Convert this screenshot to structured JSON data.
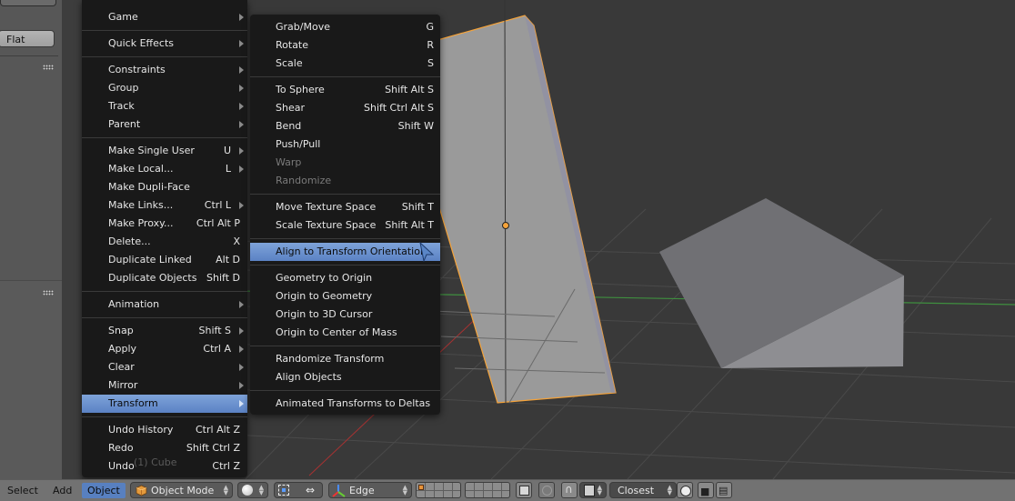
{
  "tool_shelf": {
    "shading_button": "Flat"
  },
  "viewport": {
    "object_label": "(1) Cube",
    "selection_color": "#f5a33a",
    "x_axis_color": "#a83232",
    "y_axis_color": "#3f8f3f"
  },
  "object_menu": {
    "items": [
      {
        "label": "Game",
        "shortcut": "",
        "submenu": true
      },
      {
        "label": "Quick Effects",
        "shortcut": "",
        "submenu": true
      },
      {
        "label": "Constraints",
        "shortcut": "",
        "submenu": true
      },
      {
        "label": "Group",
        "shortcut": "",
        "submenu": true
      },
      {
        "label": "Track",
        "shortcut": "",
        "submenu": true
      },
      {
        "label": "Parent",
        "shortcut": "",
        "submenu": true
      },
      {
        "label": "Make Single User",
        "shortcut": "U",
        "submenu": true
      },
      {
        "label": "Make Local...",
        "shortcut": "L",
        "submenu": true
      },
      {
        "label": "Make Dupli-Face",
        "shortcut": "",
        "submenu": false
      },
      {
        "label": "Make Links...",
        "shortcut": "Ctrl L",
        "submenu": true
      },
      {
        "label": "Make Proxy...",
        "shortcut": "Ctrl Alt P",
        "submenu": false
      },
      {
        "label": "Delete...",
        "shortcut": "X",
        "submenu": false
      },
      {
        "label": "Duplicate Linked",
        "shortcut": "Alt D",
        "submenu": false
      },
      {
        "label": "Duplicate Objects",
        "shortcut": "Shift D",
        "submenu": false
      },
      {
        "label": "Animation",
        "shortcut": "",
        "submenu": true
      },
      {
        "label": "Snap",
        "shortcut": "Shift S",
        "submenu": true
      },
      {
        "label": "Apply",
        "shortcut": "Ctrl A",
        "submenu": true
      },
      {
        "label": "Clear",
        "shortcut": "",
        "submenu": true
      },
      {
        "label": "Mirror",
        "shortcut": "",
        "submenu": true
      },
      {
        "label": "Transform",
        "shortcut": "",
        "submenu": true,
        "active": true
      },
      {
        "label": "Undo History",
        "shortcut": "Ctrl Alt Z",
        "submenu": false
      },
      {
        "label": "Redo",
        "shortcut": "Shift Ctrl Z",
        "submenu": false
      },
      {
        "label": "Undo",
        "shortcut": "Ctrl Z",
        "submenu": false
      }
    ]
  },
  "transform_menu": {
    "items": [
      {
        "label": "Grab/Move",
        "shortcut": "G"
      },
      {
        "label": "Rotate",
        "shortcut": "R"
      },
      {
        "label": "Scale",
        "shortcut": "S"
      },
      {
        "label": "To Sphere",
        "shortcut": "Shift Alt S"
      },
      {
        "label": "Shear",
        "shortcut": "Shift Ctrl Alt S"
      },
      {
        "label": "Bend",
        "shortcut": "Shift W"
      },
      {
        "label": "Push/Pull",
        "shortcut": ""
      },
      {
        "label": "Warp",
        "shortcut": "",
        "disabled": true
      },
      {
        "label": "Randomize",
        "shortcut": "",
        "disabled": true
      },
      {
        "label": "Move Texture Space",
        "shortcut": "Shift T"
      },
      {
        "label": "Scale Texture Space",
        "shortcut": "Shift Alt T"
      },
      {
        "label": "Align to Transform Orientation",
        "shortcut": "",
        "active": true
      },
      {
        "label": "Geometry to Origin",
        "shortcut": ""
      },
      {
        "label": "Origin to Geometry",
        "shortcut": ""
      },
      {
        "label": "Origin to 3D Cursor",
        "shortcut": ""
      },
      {
        "label": "Origin to Center of Mass",
        "shortcut": ""
      },
      {
        "label": "Randomize Transform",
        "shortcut": ""
      },
      {
        "label": "Align Objects",
        "shortcut": ""
      },
      {
        "label": "Animated Transforms to Deltas",
        "shortcut": ""
      }
    ]
  },
  "header": {
    "menus": [
      "Select",
      "Add",
      "Object"
    ],
    "active_menu": "Object",
    "mode": "Object Mode",
    "pivot": "Edge",
    "snap_target": "Closest",
    "accent_color": "#5880c0"
  }
}
